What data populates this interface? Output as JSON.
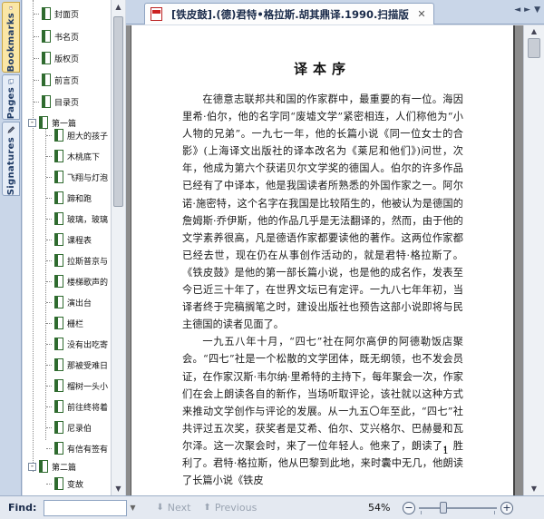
{
  "side_tabs": [
    {
      "label": "Bookmarks",
      "icon": "bookmark-icon",
      "active": true
    },
    {
      "label": "Pages",
      "icon": "pages-icon",
      "active": false
    },
    {
      "label": "Signatures",
      "icon": "pen-icon",
      "active": false
    }
  ],
  "bookmarks": [
    {
      "label": "封面页"
    },
    {
      "label": "书名页"
    },
    {
      "label": "版权页"
    },
    {
      "label": "前言页"
    },
    {
      "label": "目录页"
    },
    {
      "label": "第一篇",
      "expand": "-"
    },
    {
      "label": "胆大的孩子"
    },
    {
      "label": "木桃底下"
    },
    {
      "label": "飞翔与灯泡"
    },
    {
      "label": "蹄和跑"
    },
    {
      "label": "玻璃，玻璃"
    },
    {
      "label": "课程表"
    },
    {
      "label": "拉斯普京与"
    },
    {
      "label": "楼梯歌声的"
    },
    {
      "label": "演出台"
    },
    {
      "label": "栅栏"
    },
    {
      "label": "没有出吃寄"
    },
    {
      "label": "那被受难日"
    },
    {
      "label": "榴树一头小"
    },
    {
      "label": "前往终将着"
    },
    {
      "label": "尼录伯"
    },
    {
      "label": "有信有签有"
    },
    {
      "label": "第二篇",
      "expand": "-"
    },
    {
      "label": "变故"
    }
  ],
  "document_tab": {
    "title": "[铁皮鼓].(德)君特•格拉斯.胡其鼎译.1990.扫描版",
    "close": "✕"
  },
  "tab_nav": {
    "prev": "◄",
    "next": "►",
    "menu": "▼"
  },
  "document": {
    "heading": "译本序",
    "paragraphs": [
      "在德意志联邦共和国的作家群中，最重要的有一位。海因里希·伯尔，他的名字同“废墟文学”紧密相连，人们称他为“小人物的兄弟”。一九七一年，他的长篇小说《同一位女士的合影》(上海译文出版社的译本改名为《莱尼和他们》)问世，次年，他成为第六个获诺贝尔文学奖的德国人。伯尔的许多作品已经有了中译本，他是我国读者所熟悉的外国作家之一。阿尔诺·施密特，这个名字在我国是比较陌生的，他被认为是德国的詹姆斯·乔伊斯，他的作品几乎是无法翻译的，然而，由于他的文学素养很高，凡是德语作家都要读他的著作。这两位作家都已经去世，现在仍在从事创作活动的，就是君特·格拉斯了。《铁皮鼓》是他的第一部长篇小说，也是他的成名作，发表至今已近三十年了，在世界文坛已有定评。一九八七年年初，当译者终于完稿搁笔之时，建设出版社也预告这部小说即将与民主德国的读者见面了。",
      "一九五八年十月，“四七”社在阿尔高伊的阿德勒饭店聚会。“四七”社是一个松散的文学团体，既无纲领，也不发会员证，在作家汉斯·韦尔纳·里希特的主持下，每年聚会一次，作家们在会上朗读各自的新作，当场听取评论，该社就以这种方式来推动文学创作与评论的发展。从一九五〇年至此，“四七”社共评过五次奖，获奖者是艾希、伯尔、艾兴格尔、巴赫曼和瓦尔泽。这一次聚会时，来了一位年轻人。他来了，朗读了，胜利了。君特·格拉斯，他从巴黎到此地，来时囊中无几，他朗读了长篇小说《铁皮"
    ],
    "page_number": "1"
  },
  "findbar": {
    "label": "Find:",
    "placeholder": "",
    "next": "Next",
    "previous": "Previous",
    "zoom": "54%",
    "zoom_level_percent": 54
  }
}
